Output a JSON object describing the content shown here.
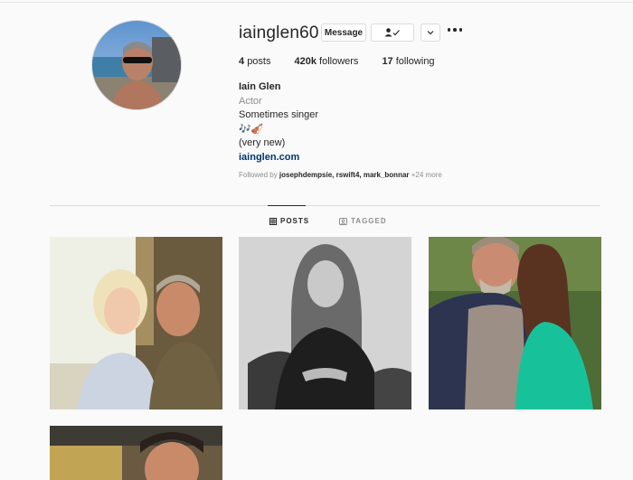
{
  "profile": {
    "username": "iainglen60",
    "message_label": "Message",
    "posts_count": "4",
    "posts_label": "posts",
    "followers_count": "420k",
    "followers_label": "followers",
    "following_count": "17",
    "following_label": "following"
  },
  "bio": {
    "name": "Iain Glen",
    "category": "Actor",
    "line1": "Sometimes singer",
    "line2": "🎶🎻",
    "line3": "(very new)",
    "link": "iainglen.com"
  },
  "followed_by": {
    "prefix": "Followed by ",
    "users": "josephdempsie, rswift4, mark_bonnar",
    "more": " +24 more"
  },
  "tabs": {
    "posts": "POSTS",
    "tagged": "TAGGED"
  },
  "icons": {
    "follow": "person-check-icon",
    "chevron": "chevron-down-icon",
    "more": "more-horizontal-icon",
    "posts_tab": "grid-icon",
    "tagged_tab": "tag-icon"
  },
  "colors": {
    "link": "#00376b",
    "muted": "#8e8e8e",
    "text": "#262626",
    "background": "#fafafa"
  }
}
